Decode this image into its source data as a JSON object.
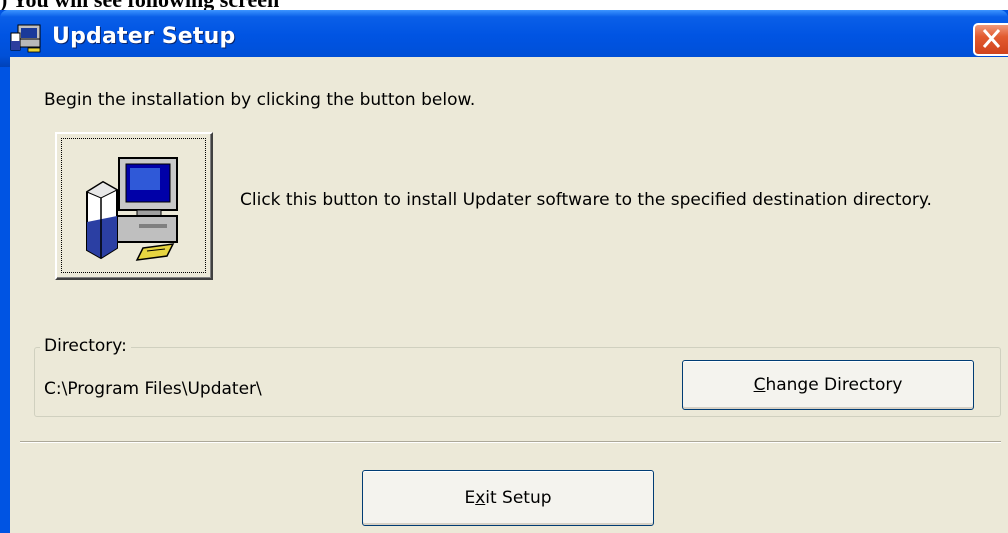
{
  "window": {
    "title": "Updater Setup",
    "icons": {
      "app": "setup-icon",
      "close": "close-icon"
    }
  },
  "dialog": {
    "intro": "Begin the installation by clicking the button below.",
    "install_description": "Click this button to install Updater software to the specified destination directory.",
    "install_button_icon": "computer-install-icon",
    "directory_group_label": "Directory:",
    "directory_value": "C:\\Program Files\\Updater\\",
    "change_directory": {
      "pre": "",
      "key": "C",
      "post": "hange Directory"
    },
    "exit_setup": {
      "pre": "E",
      "key": "x",
      "post": "it Setup"
    }
  },
  "colors": {
    "titlebar": "#0054e3",
    "client_bg": "#ece9d8",
    "close_button": "#e25b30"
  }
}
